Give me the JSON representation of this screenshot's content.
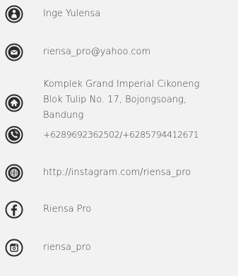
{
  "contacts": {
    "name": {
      "icon": "person-icon",
      "text": "Inge Yulensa"
    },
    "email": {
      "icon": "envelope-icon",
      "text": "riensa_pro@yahoo.com"
    },
    "address": {
      "icon": "home-icon",
      "line1": "Komplek Grand Imperial Cikoneng",
      "line2": "Blok Tulip No. 17, Bojongsoang,",
      "line3": "Bandung"
    },
    "phone": {
      "icon": "phone-icon",
      "text": "+6289692362502/+6285794412671"
    },
    "website": {
      "icon": "globe-icon",
      "text": "http://instagram.com/riensa_pro"
    },
    "facebook": {
      "icon": "facebook-icon",
      "text": "Riensa Pro"
    },
    "instagram": {
      "icon": "instagram-icon",
      "text": "riensa_pro"
    }
  },
  "colors": {
    "background": "#f2f2f2",
    "icon_dark": "#2b2b2b",
    "text": "#3a3a3a"
  }
}
